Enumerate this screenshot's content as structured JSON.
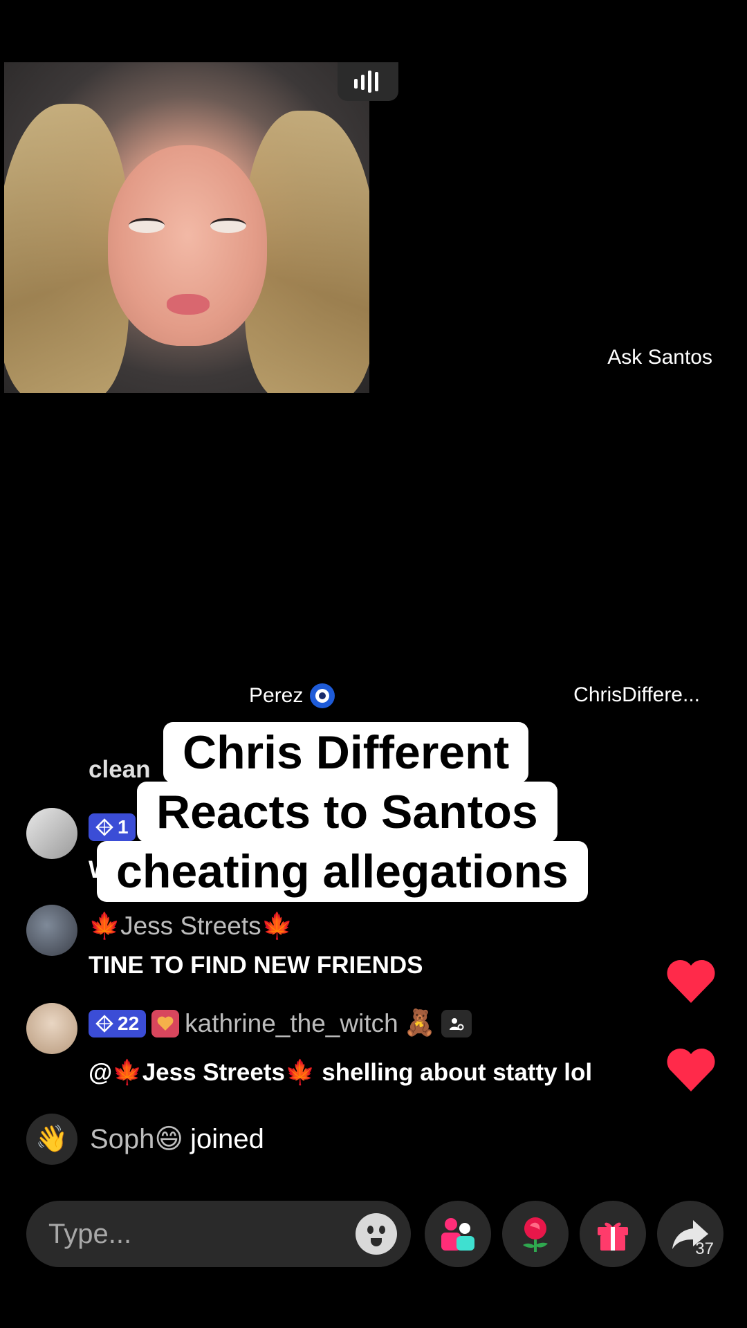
{
  "stream": {
    "host_tile_name": "Ask Santos",
    "guest_left_name": "Perez",
    "guest_right_name": "ChrisDiffere..."
  },
  "caption": {
    "line1": "Chris Different",
    "line2": "Reacts to Santos",
    "line3": "cheating allegations"
  },
  "chat": {
    "faded_text": "clean",
    "badge_partial": "1",
    "partial_letter": "W",
    "msg2_name": "🍁Jess Streets🍁",
    "msg2_text": "TINE TO FIND NEW FRIENDS",
    "msg3_badge_level": "22",
    "msg3_name": "kathrine_the_witch",
    "msg3_name_emoji": "🧸",
    "msg3_text": "@🍁Jess Streets🍁 shelling about statty lol"
  },
  "joined": {
    "user": "Soph😄",
    "text": "joined",
    "icon": "wave-hand-icon"
  },
  "bottom_bar": {
    "input_placeholder": "Type...",
    "share_count": "37"
  },
  "colors": {
    "heart": "#ff2a4a",
    "badge_blue": "#3b4dd6",
    "badge_pink": "#d8465d",
    "background": "#000000"
  }
}
